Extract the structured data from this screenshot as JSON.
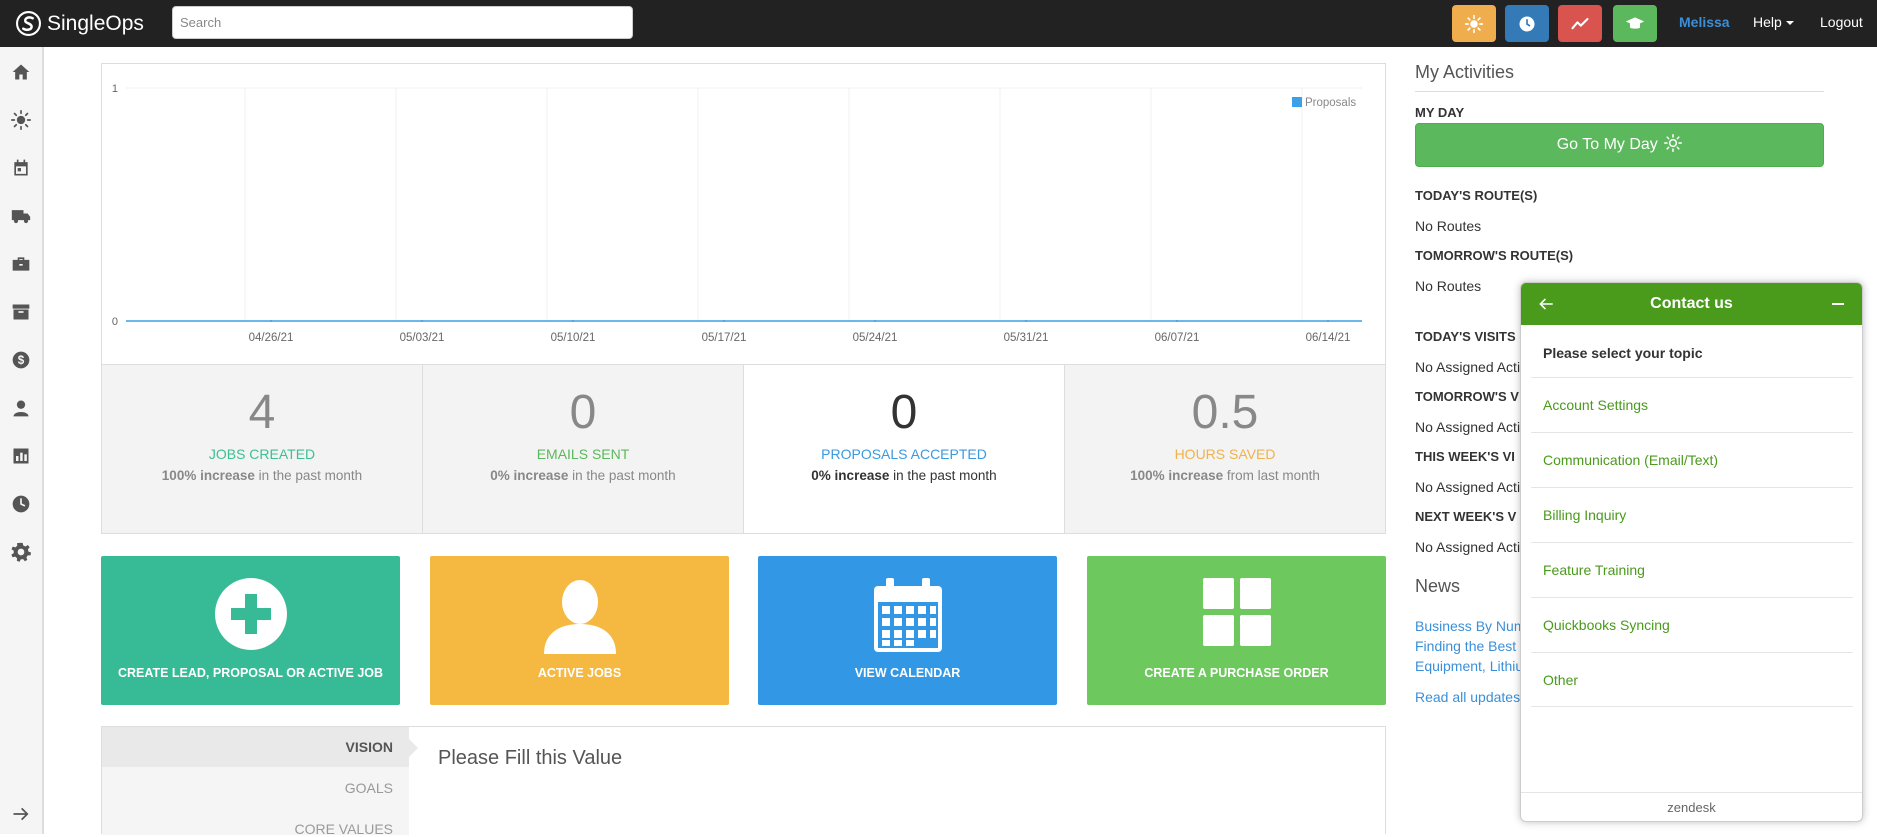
{
  "app": {
    "brand": "SingleOps"
  },
  "search": {
    "placeholder": "Search"
  },
  "topnav": {
    "user": "Melissa",
    "help": "Help",
    "logout": "Logout",
    "quick_buttons": [
      {
        "icon": "sun-icon",
        "color": "#f0ad4e"
      },
      {
        "icon": "clock-icon",
        "color": "#337ab7"
      },
      {
        "icon": "trend-icon",
        "color": "#d9534f"
      },
      {
        "icon": "graduation-cap-icon",
        "color": "#5cb85c"
      }
    ]
  },
  "sidebar": {
    "icons": [
      "home-icon",
      "sun-icon",
      "calendar-icon",
      "truck-icon",
      "briefcase-icon",
      "archive-icon",
      "dollar-icon",
      "user-icon",
      "bar-chart-icon",
      "clock-icon",
      "gear-icon",
      "expand-arrow-icon"
    ]
  },
  "chart_data": {
    "type": "line",
    "series": [
      {
        "name": "Proposals",
        "color": "#3aa0e8",
        "values": [
          0,
          0,
          0,
          0,
          0,
          0,
          0,
          0
        ]
      }
    ],
    "x": [
      "04/26/21",
      "05/03/21",
      "05/10/21",
      "05/17/21",
      "05/24/21",
      "05/31/21",
      "06/07/21",
      "06/14/21"
    ],
    "yticks": [
      "0",
      "1"
    ],
    "ylim": [
      0,
      1
    ],
    "legend": "top-right",
    "grid": true
  },
  "stats": [
    {
      "value": "4",
      "label": "JOBS CREATED",
      "label_color": "#3cbf95",
      "bold": "100% increase",
      "rest": " in the past month"
    },
    {
      "value": "0",
      "label": "EMAILS SENT",
      "label_color": "#5cb85c",
      "bold": "0% increase",
      "rest": " in the past month"
    },
    {
      "value": "0",
      "label": "PROPOSALS ACCEPTED",
      "label_color": "#3a9ae0",
      "bold": "0% increase",
      "rest": " in the past month"
    },
    {
      "value": "0.5",
      "label": "HOURS SAVED",
      "label_color": "#f0b24a",
      "bold": "100% increase",
      "rest": " from last month"
    }
  ],
  "tiles": [
    {
      "label": "CREATE LEAD, PROPOSAL OR ACTIVE JOB",
      "color": "#37bb96",
      "icon": "plus-circle-icon"
    },
    {
      "label": "ACTIVE JOBS",
      "color": "#f5b841",
      "icon": "person-icon"
    },
    {
      "label": "VIEW CALENDAR",
      "color": "#3298e5",
      "icon": "calendar-icon"
    },
    {
      "label": "CREATE A PURCHASE ORDER",
      "color": "#6dc95e",
      "icon": "grid-icon"
    }
  ],
  "vision": {
    "tabs": [
      "VISION",
      "GOALS",
      "CORE VALUES"
    ],
    "content": "Please Fill this Value"
  },
  "activities": {
    "title": "My Activities",
    "my_day_heading": "MY DAY",
    "my_day_button": "Go To My Day",
    "sections": [
      {
        "heading": "TODAY'S ROUTE(S)",
        "text": "No Routes"
      },
      {
        "heading": "TOMORROW'S ROUTE(S)",
        "text": "No Routes"
      },
      {
        "heading": "TODAY'S VISITS",
        "text": "No Assigned Acti"
      },
      {
        "heading": "TOMORROW'S V",
        "text": "No Assigned Acti"
      },
      {
        "heading": "THIS WEEK'S VI",
        "text": "No Assigned Acti"
      },
      {
        "heading": "NEXT WEEK'S V",
        "text": "No Assigned Acti"
      }
    ]
  },
  "news": {
    "title": "News",
    "links": [
      "Business By Num",
      "Finding the Best",
      "Equipment, Lithiu"
    ],
    "read_all": "Read all updates"
  },
  "contact": {
    "title": "Contact us",
    "prompt": "Please select your topic",
    "topics": [
      "Account Settings",
      "Communication (Email/Text)",
      "Billing Inquiry",
      "Feature Training",
      "Quickbooks Syncing",
      "Other"
    ],
    "footer": "zendesk"
  }
}
